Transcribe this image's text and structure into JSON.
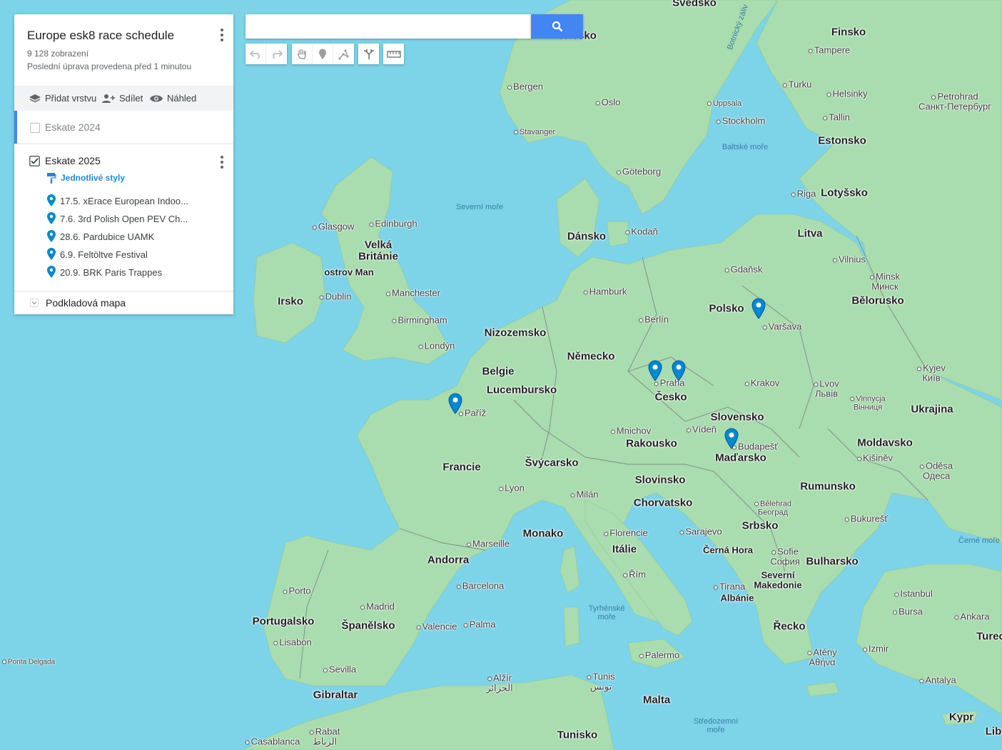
{
  "panel": {
    "title": "Europe esk8 race schedule",
    "views": "9 128 zobrazení",
    "last_edit": "Poslední úprava provedena před 1 minutou",
    "actions": {
      "add_layer": "Přidat vrstvu",
      "share": "Sdílet",
      "preview": "Náhled"
    },
    "layers": [
      {
        "name": "Eskate 2024",
        "checked": false
      },
      {
        "name": "Eskate 2025",
        "checked": true,
        "style_link": "Jednotlivé styly",
        "items": [
          "17.5. xErace European Indoo...",
          "7.6. 3rd Polish Open PEV Ch...",
          "28.6. Pardubice UAMK",
          "6.9. Feltöltve Festival",
          "20.9. BRK Paris Trappes"
        ]
      }
    ],
    "base_map": "Podkladová mapa"
  },
  "search": {
    "placeholder": ""
  },
  "colors": {
    "accent": "#4285f4",
    "pin": "#0288d1",
    "layer_selected": "#4285f4",
    "link": "#1e88e5"
  },
  "map": {
    "countries": [
      "Finsko",
      "Estonsko",
      "Lotyšsko",
      "Litva",
      "Bělorusko",
      "Polsko",
      "Dánsko",
      "Velká Británie",
      "Irsko",
      "ostrov Man",
      "Nizozemsko",
      "Belgie",
      "Lucembursko",
      "Německo",
      "Česko",
      "Slovensko",
      "Ukrajina",
      "Moldavsko",
      "Rakousko",
      "Maďarsko",
      "Rumunsko",
      "Francie",
      "Švýcarsko",
      "Slovinsko",
      "Chorvatsko",
      "Srbsko",
      "Bulharsko",
      "Monako",
      "Itálie",
      "Andorra",
      "Portugalsko",
      "Španělsko",
      "Gibraltar",
      "Albánie",
      "Severní Makedonie",
      "Řecko",
      "Malta",
      "Tunisko",
      "Kypr",
      "Černá Hora",
      "Turec",
      "Lib",
      "Švédsko",
      "Norsko"
    ],
    "cities": [
      "Tampere",
      "Turku",
      "Helsinky",
      "Petrohrad Санкт-Петербург",
      "Tallin",
      "Uppsala",
      "Stockholm",
      "Oslo",
      "Bergen",
      "Stavanger",
      "Göteborg",
      "Riga",
      "Vilnius",
      "Minsk Минск",
      "Gdaňsk",
      "Kodaň",
      "Edinburgh",
      "Glasgow",
      "Dublin",
      "Manchester",
      "Birmingham",
      "Londýn",
      "Hamburk",
      "Berlín",
      "Varšava",
      "Praha",
      "Krakov",
      "Lvov Львів",
      "Kyjev Київ",
      "Vinnycja Вінниця",
      "Mnichov",
      "Vídeň",
      "Budapešť",
      "Kišiněv",
      "Oděsa Одеса",
      "Paříž",
      "Lyon",
      "Milán",
      "Marseille",
      "Florencie",
      "Sarajevo",
      "Bělehrad Београд",
      "Bukurešť",
      "Sofie София",
      "Řím",
      "Barcelona",
      "Madrid",
      "Porto",
      "Lisabon",
      "Valencie",
      "Palma",
      "Sevilla",
      "Alžír الجزائر",
      "Tunis تونس",
      "Palermo",
      "Rabat الرباط",
      "Casablanca",
      "Istanbul",
      "Bursa",
      "Ankara",
      "Izmir",
      "Antalya",
      "Atény Αθήνα",
      "Tirana",
      "Ponta Delgada"
    ],
    "seas": [
      "Severní moře",
      "Baltské moře",
      "Botnický záliv",
      "Tyrhénské moře",
      "Středozemní moře",
      "Černé moře"
    ]
  }
}
